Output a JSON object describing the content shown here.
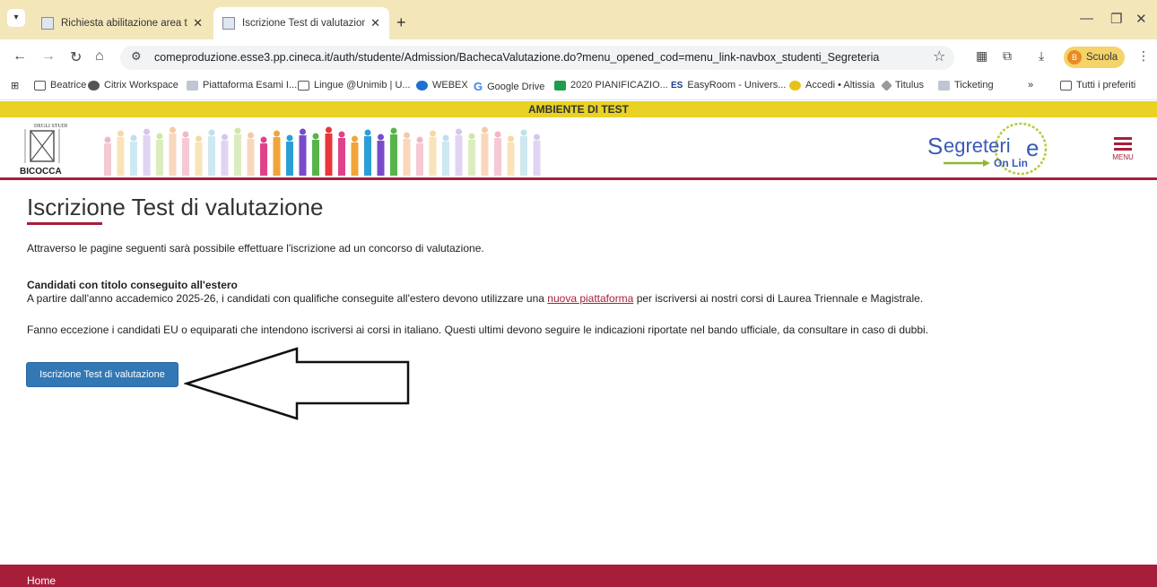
{
  "browser": {
    "tabs": [
      {
        "title": "Richiesta abilitazione area test"
      },
      {
        "title": "Iscrizione Test di valutazione, Se"
      }
    ],
    "url": "comeproduzione.esse3.pp.cineca.it/auth/studente/Admission/BachecaValutazione.do?menu_opened_cod=menu_link-navbox_studenti_Segreteria",
    "profile_initial": "B",
    "profile_name": "Scuola",
    "bookmarks": [
      "Beatrice",
      "Citrix Workspace",
      "Piattaforma Esami I...",
      "Lingue @Unimib | U...",
      "WEBEX",
      "Google Drive",
      "2020 PIANIFICAZIO...",
      "EasyRoom - Univers...",
      "Accedi • Altissia",
      "Titulus",
      "Ticketing"
    ],
    "bookmarks_overflow": "»",
    "all_bookmarks": "Tutti i preferiti"
  },
  "env_banner": "AMBIENTE DI TEST",
  "header": {
    "uni_logo_text": "BICOCCA",
    "menu_label": "MENU"
  },
  "page": {
    "title": "Iscrizione Test di valutazione",
    "intro": "Attraverso le pagine seguenti sarà possibile effettuare l'iscrizione ad un concorso di valutazione.",
    "foreign_heading": "Candidati con titolo conseguito all'estero",
    "foreign_text_before": "A partire dall'anno accademico 2025-26, i candidati con qualifiche conseguite all'estero devono utilizzare una ",
    "foreign_link": "nuova piattaforma",
    "foreign_text_after": " per iscriversi ai nostri corsi di Laurea Triennale e Magistrale.",
    "exception": "Fanno eccezione i candidati EU o equiparati che intendono iscriversi ai corsi in italiano. Questi ultimi devono seguire le indicazioni riportate nel bando ufficiale, da consultare in caso di dubbi.",
    "button": "Iscrizione Test di valutazione"
  },
  "footer": {
    "home": "Home"
  },
  "colors": {
    "brand": "#a71e3b",
    "env": "#e9d224",
    "button": "#3278b5"
  }
}
